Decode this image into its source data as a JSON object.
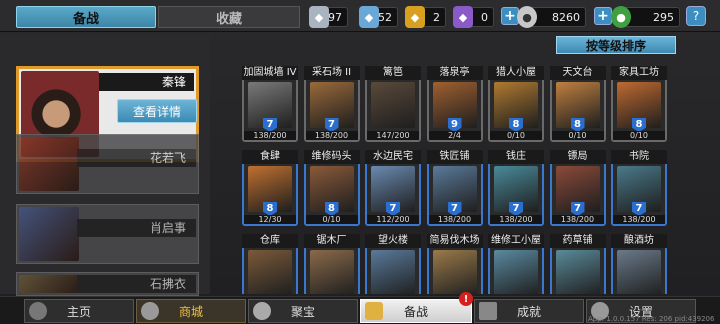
{
  "tabs": {
    "active": "备战",
    "inactive": "收藏"
  },
  "resources": [
    {
      "icon": "silver-shield-icon",
      "value": "97",
      "color": "#aab4c0"
    },
    {
      "icon": "blue-shield-icon",
      "value": "52",
      "color": "#6aa8d8"
    },
    {
      "icon": "gold-shield-icon",
      "value": "2",
      "color": "#d8a020"
    },
    {
      "icon": "purple-shield-icon",
      "value": "0",
      "color": "#8a5ac8"
    }
  ],
  "currency": {
    "coins": "8260",
    "gems": "295"
  },
  "help": "?",
  "sort_label": "按等级排序",
  "heroes": [
    {
      "name": "秦锋",
      "detail": "查看详情"
    },
    {
      "name": "花若飞"
    },
    {
      "name": "肖启事"
    },
    {
      "name": "石拂衣"
    }
  ],
  "buildings": [
    {
      "name": "加固城墙 IV",
      "level": "7",
      "progress": "138/200",
      "blue": false,
      "color": "#7a7a7a"
    },
    {
      "name": "采石场 II",
      "level": "7",
      "progress": "138/200",
      "blue": false,
      "color": "#9a6a3a"
    },
    {
      "name": "篱笆",
      "level": "",
      "progress": "147/200",
      "blue": false,
      "color": "#5a4a3a"
    },
    {
      "name": "落泉亭",
      "level": "9",
      "progress": "2/4",
      "blue": false,
      "color": "#a06030"
    },
    {
      "name": "猎人小屋",
      "level": "8",
      "progress": "0/10",
      "blue": false,
      "color": "#b07a30"
    },
    {
      "name": "天文台",
      "level": "8",
      "progress": "0/10",
      "blue": false,
      "color": "#c08040"
    },
    {
      "name": "家具工坊",
      "level": "8",
      "progress": "0/10",
      "blue": false,
      "color": "#c06a30"
    },
    {
      "name": "食肆",
      "level": "8",
      "progress": "12/30",
      "blue": true,
      "color": "#c07030"
    },
    {
      "name": "维修码头",
      "level": "8",
      "progress": "0/10",
      "blue": true,
      "color": "#8a5a3a"
    },
    {
      "name": "水边民宅",
      "level": "7",
      "progress": "112/200",
      "blue": true,
      "color": "#6a8ab0"
    },
    {
      "name": "铁匠铺",
      "level": "7",
      "progress": "138/200",
      "blue": true,
      "color": "#5a7a9a"
    },
    {
      "name": "钱庄",
      "level": "7",
      "progress": "138/200",
      "blue": true,
      "color": "#4a8a9a"
    },
    {
      "name": "镖局",
      "level": "7",
      "progress": "138/200",
      "blue": true,
      "color": "#8a4a3a"
    },
    {
      "name": "书院",
      "level": "7",
      "progress": "138/200",
      "blue": true,
      "color": "#4a7a8a"
    },
    {
      "name": "仓库",
      "level": "",
      "progress": "",
      "blue": true,
      "color": "#7a5a3a"
    },
    {
      "name": "锯木厂",
      "level": "",
      "progress": "",
      "blue": true,
      "color": "#8a6a4a"
    },
    {
      "name": "望火楼",
      "level": "",
      "progress": "",
      "blue": true,
      "color": "#5a7a9a"
    },
    {
      "name": "简易伐木场",
      "level": "",
      "progress": "",
      "blue": true,
      "color": "#9a7a4a"
    },
    {
      "name": "维修工小屋",
      "level": "",
      "progress": "",
      "blue": true,
      "color": "#5a8aa0"
    },
    {
      "name": "药草铺",
      "level": "",
      "progress": "",
      "blue": true,
      "color": "#5a8a9a"
    },
    {
      "name": "酿酒坊",
      "level": "",
      "progress": "",
      "blue": true,
      "color": "#6a7a8a"
    }
  ],
  "nav": [
    {
      "label": "主页"
    },
    {
      "label": "商城"
    },
    {
      "label": "聚宝"
    },
    {
      "label": "备战"
    },
    {
      "label": "成就"
    },
    {
      "label": "设置"
    }
  ],
  "nav_badge": "!",
  "version": "App: 1.0.0.157 Res: 206 pid:439206"
}
